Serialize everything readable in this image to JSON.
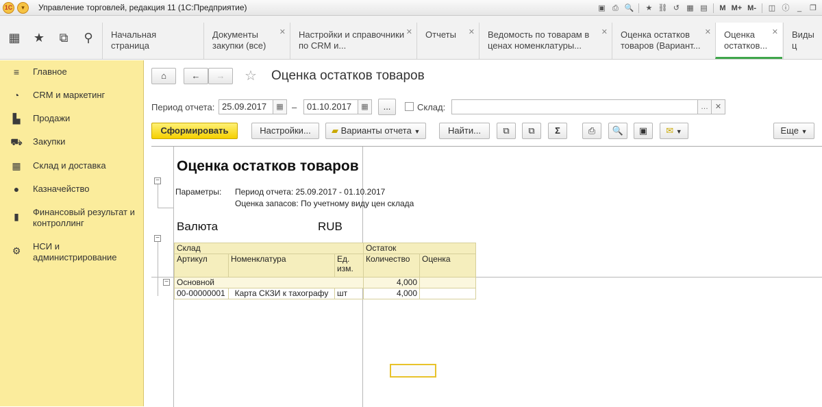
{
  "titlebar": {
    "title": "Управление торговлей, редакция 11  (1С:Предприятие)",
    "m": "M",
    "mplus": "M+",
    "mminus": "M-"
  },
  "quick": {
    "apps_icon": "grid-icon",
    "fav_icon": "star-icon",
    "history_icon": "history-icon",
    "search_icon": "search-icon"
  },
  "tabs": [
    {
      "label": "Начальная страница"
    },
    {
      "label": "Документы закупки (все)"
    },
    {
      "label": "Настройки и справочники по CRM и..."
    },
    {
      "label": "Отчеты"
    },
    {
      "label": "Ведомость по товарам в ценах номенклатуры..."
    },
    {
      "label": "Оценка остатков товаров (Вариант..."
    },
    {
      "label": "Оценка остатков..."
    },
    {
      "label": "Виды ц"
    }
  ],
  "sidebar": {
    "items": [
      {
        "label": "Главное",
        "icon": "menu-icon"
      },
      {
        "label": "CRM и маркетинг",
        "icon": "pie-icon"
      },
      {
        "label": "Продажи",
        "icon": "bag-icon"
      },
      {
        "label": "Закупки",
        "icon": "cart-icon"
      },
      {
        "label": "Склад и доставка",
        "icon": "warehouse-icon"
      },
      {
        "label": "Казначейство",
        "icon": "coin-icon"
      },
      {
        "label": "Финансовый результат и контроллинг",
        "icon": "bars-icon"
      },
      {
        "label": "НСИ и администрирование",
        "icon": "gear-icon"
      }
    ]
  },
  "form": {
    "title": "Оценка остатков товаров",
    "period_label": "Период отчета:",
    "date_from": "25.09.2017",
    "date_to": "01.10.2017",
    "dash": "–",
    "ellipsis": "...",
    "warehouse_label": "Склад:",
    "warehouse_value": "",
    "generate": "Сформировать",
    "settings": "Настройки...",
    "variants": "Варианты отчета",
    "find": "Найти...",
    "sum": "Σ",
    "more": "Еще"
  },
  "report": {
    "title": "Оценка остатков товаров",
    "params_label": "Параметры:",
    "param1": "Период отчета: 25.09.2017 - 01.10.2017",
    "param2": "Оценка запасов: По учетному виду цен склада",
    "currency_label": "Валюта",
    "currency_value": "RUB",
    "headers": {
      "warehouse": "Склад",
      "balance": "Остаток",
      "article": "Артикул",
      "item": "Номенклатура",
      "unit": "Ед. изм.",
      "qty": "Количество",
      "value": "Оценка"
    },
    "group": {
      "name": "Основной",
      "qty": "4,000",
      "value": ""
    },
    "rows": [
      {
        "article": "00-00000001",
        "item": "Карта СКЗИ к тахографу",
        "unit": "шт",
        "qty": "4,000",
        "value": ""
      }
    ]
  }
}
